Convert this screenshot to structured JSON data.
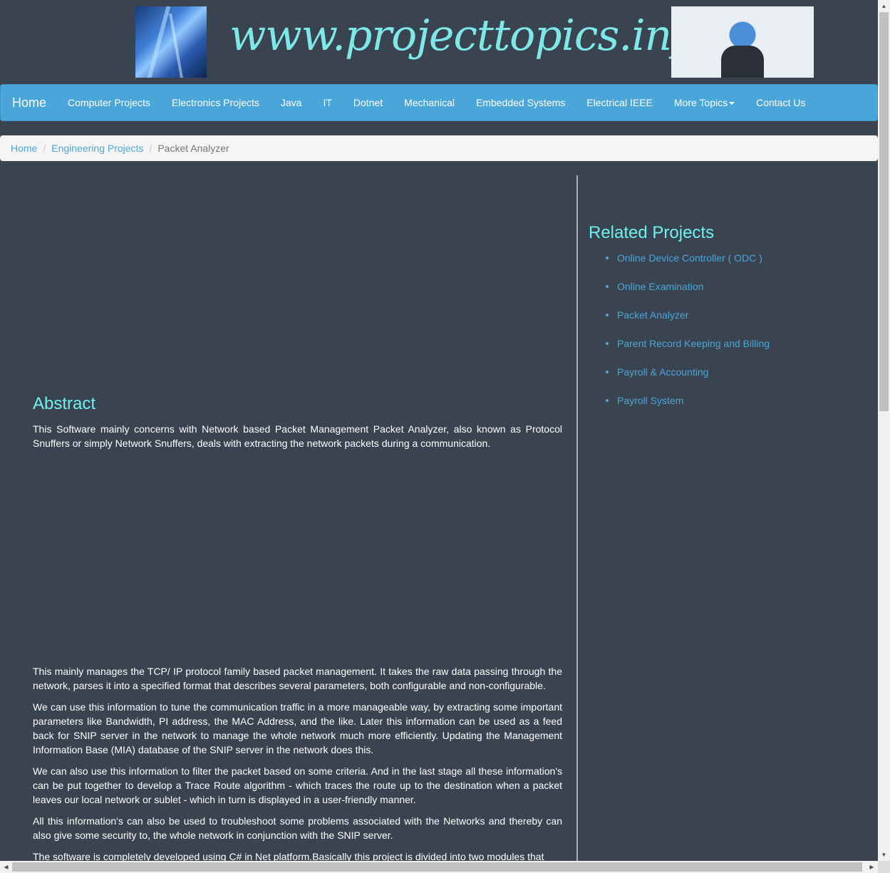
{
  "header": {
    "site_title": "www.projecttopics.info",
    "left_image": "network-city-image",
    "right_image": "globe-network-image"
  },
  "navbar": {
    "brand": "Home",
    "items": [
      {
        "label": "Computer Projects"
      },
      {
        "label": "Electronics Projects"
      },
      {
        "label": "Java"
      },
      {
        "label": "IT"
      },
      {
        "label": "Dotnet"
      },
      {
        "label": "Mechanical"
      },
      {
        "label": "Embedded Systems"
      },
      {
        "label": "Electrical IEEE"
      },
      {
        "label": "More Topics",
        "dropdown": true
      },
      {
        "label": "Contact Us"
      }
    ]
  },
  "breadcrumb": {
    "home": "Home",
    "category": "Engineering Projects",
    "current": "Packet Analyzer"
  },
  "main": {
    "abstract_heading": "Abstract",
    "paragraphs": [
      "This Software mainly concerns with Network based Packet Management Packet Analyzer, also known as Protocol Snuffers or simply Network Snuffers, deals with extracting the network packets during a communication.",
      "This mainly manages the TCP/ IP protocol family based packet management. It takes the raw data passing through the network, parses it into a specified format that describes several parameters, both configurable and non-configurable.",
      "We can use this information to tune the communication traffic in a more manageable way, by extracting some important parameters like Bandwidth, PI address, the MAC Address, and the like. Later this information can be used as a feed back for SNIP server in the network to manage the whole network much more efficiently. Updating the Management Information Base (MIA) database of the SNIP server in the network does this.",
      "We can also use this information to filter the packet based on some criteria. And in the last stage all these information's can be put together to develop a Trace Route algorithm - which traces the route up to the destination when a packet leaves our local network or sublet - which in turn is displayed in a user-friendly manner.",
      "All this information's can also be used to troubleshoot some problems associated with the Networks and thereby can also give some security to, the whole network in conjunction with the SNIP server.",
      "The software is completely developed using C# in Net platform.Basically this project is divided into two modules that"
    ]
  },
  "sidebar": {
    "heading": "Related Projects",
    "items": [
      "Online Device Controller ( ODC )",
      "Online Examination",
      "Packet Analyzer",
      "Parent Record Keeping and Billing",
      "Payroll & Accounting",
      "Payroll System"
    ]
  },
  "colors": {
    "background": "#3a4350",
    "navbar": "#4aa6d8",
    "heading": "#6ff0f0",
    "link": "#4aa6d8"
  }
}
